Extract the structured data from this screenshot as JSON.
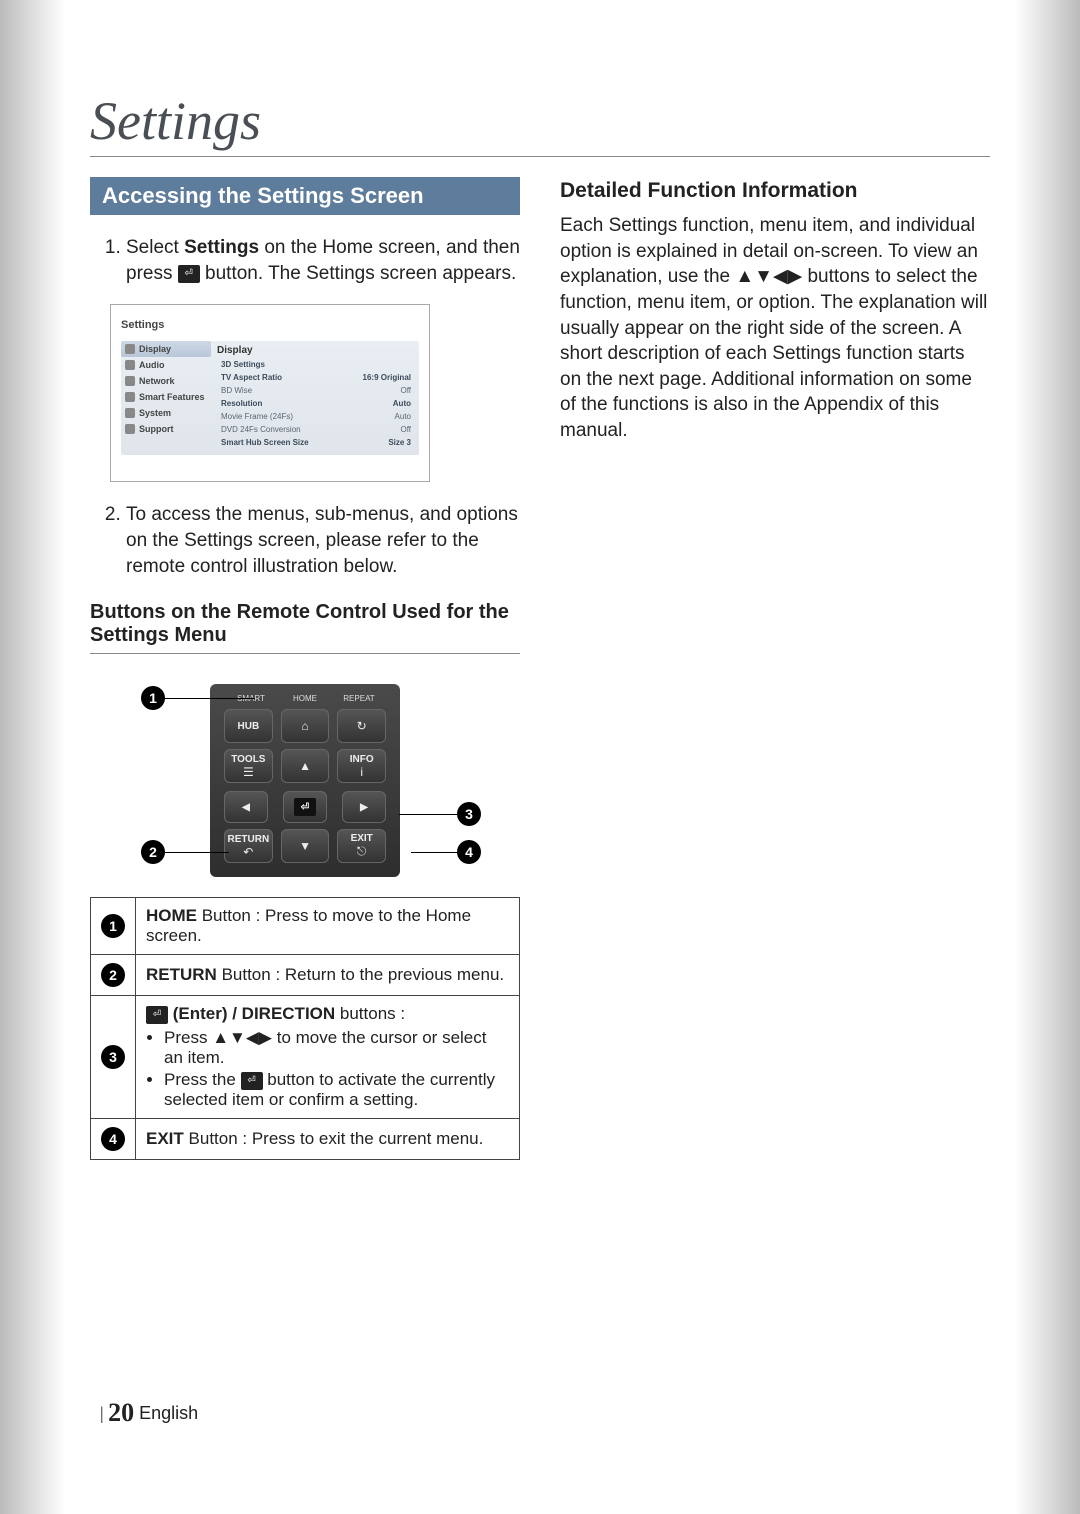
{
  "title": "Settings",
  "left": {
    "section_head": "Accessing the Settings Screen",
    "steps": {
      "s1_a": "Select ",
      "s1_b": "Settings",
      "s1_c": " on the Home screen, and then press ",
      "s1_d": " button. The Settings screen appears.",
      "s2": "To access the menus, sub-menus, and options on the Settings screen, please refer to the remote control illustration below."
    },
    "subhead": "Buttons on the Remote Control Used for the Settings Menu",
    "remote": {
      "smart": "SMART",
      "home": "HOME",
      "repeat": "REPEAT",
      "hub": "HUB",
      "tools": "TOOLS",
      "info": "INFO",
      "return": "RETURN",
      "exit": "EXIT"
    },
    "callouts": {
      "c1": "1",
      "c2": "2",
      "c3": "3",
      "c4": "4"
    },
    "table": {
      "r1_a": "HOME",
      "r1_b": " Button : Press to move to the Home screen.",
      "r2_a": "RETURN",
      "r2_b": " Button : Return to the previous menu.",
      "r3_head_a": " (Enter) / DIRECTION",
      "r3_head_b": " buttons :",
      "r3_li1_a": "Press ",
      "r3_li1_arrows": "▲▼◀▶",
      "r3_li1_b": " to move the cursor or select an item.",
      "r3_li2_a": "Press the ",
      "r3_li2_b": " button to activate the currently selected item or confirm a setting.",
      "r4_a": "EXIT",
      "r4_b": " Button : Press to exit the current menu."
    }
  },
  "screenshot": {
    "top": "Settings",
    "side": [
      "Display",
      "Audio",
      "Network",
      "Smart Features",
      "System",
      "Support"
    ],
    "main_title": "Display",
    "rows": [
      {
        "k": "3D Settings",
        "v": ""
      },
      {
        "k": "TV Aspect Ratio",
        "v": "16:9 Original"
      },
      {
        "k": "BD Wise",
        "v": "Off"
      },
      {
        "k": "Resolution",
        "v": "Auto"
      },
      {
        "k": "Movie Frame (24Fs)",
        "v": "Auto"
      },
      {
        "k": "DVD 24Fs Conversion",
        "v": "Off"
      },
      {
        "k": "Smart Hub Screen Size",
        "v": "Size 3"
      }
    ]
  },
  "right": {
    "head": "Detailed Function Information",
    "body_a": "Each Settings function, menu item, and individual option is explained in detail on-screen. To view an explanation, use the ",
    "body_arrows": "▲▼◀▶",
    "body_b": " buttons to select the function, menu item, or option. The explanation will usually appear on the right side of the screen. A short description of each Settings function starts on the next page. Additional information on some of the functions is also in the Appendix of this manual."
  },
  "footer": {
    "page": "20",
    "lang": "English"
  }
}
